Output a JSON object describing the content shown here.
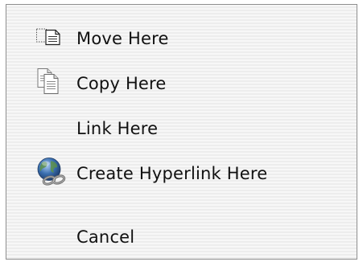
{
  "menu": {
    "items": [
      {
        "label": "Move Here",
        "icon": "move-document-icon"
      },
      {
        "label": "Copy Here",
        "icon": "copy-documents-icon"
      },
      {
        "label": "Link Here",
        "icon": ""
      },
      {
        "label": "Create Hyperlink Here",
        "icon": "globe-link-icon"
      },
      {
        "label": "Cancel",
        "icon": ""
      }
    ]
  },
  "colors": {
    "menu_background": "#f2f2f2",
    "menu_border": "#8e8e8e",
    "text": "#111111",
    "globe_blue": "#3a6fb0",
    "chain_gray": "#6e6e6e"
  }
}
